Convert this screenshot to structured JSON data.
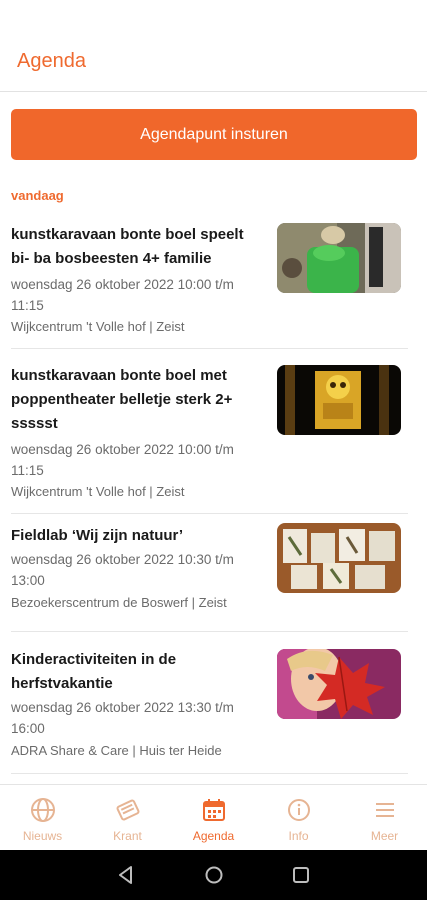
{
  "header": {
    "title": "Agenda"
  },
  "submit_button": {
    "label": "Agendapunt insturen"
  },
  "section": {
    "label": "vandaag"
  },
  "events": [
    {
      "title": "kunstkaravaan bonte boel speelt bi- ba bosbeesten 4+ familie",
      "date_line1": "woensdag 26 oktober 2022 10:00 t/m",
      "date_line2": "11:15",
      "location": "Wijkcentrum 't Volle hof | Zeist",
      "thumbnail_icon": "puppet-photo"
    },
    {
      "title": "kunstkaravaan bonte boel met poppentheater belletje sterk 2+ ssssst",
      "date_line1": "woensdag 26 oktober 2022 10:00 t/m",
      "date_line2": "11:15",
      "location": "Wijkcentrum 't Volle hof | Zeist",
      "thumbnail_icon": "theater-photo"
    },
    {
      "title": "Fieldlab ‘Wij zijn natuur’",
      "date_line1": "woensdag 26 oktober 2022 10:30 t/m",
      "date_line2": "13:00",
      "location": "Bezoekerscentrum de Boswerf | Zeist",
      "thumbnail_icon": "nature-cards-photo"
    },
    {
      "title": "Kinderactiviteiten in de herfstvakantie",
      "date_line1": "woensdag 26 oktober 2022 13:30 t/m",
      "date_line2": "16:00",
      "location": "ADRA Share & Care | Huis ter Heide",
      "thumbnail_icon": "autumn-leaf-photo"
    }
  ],
  "nav": {
    "items": [
      {
        "label": "Nieuws",
        "icon": "globe-icon"
      },
      {
        "label": "Krant",
        "icon": "newspaper-icon"
      },
      {
        "label": "Agenda",
        "icon": "calendar-icon",
        "active": true
      },
      {
        "label": "Info",
        "icon": "info-icon"
      },
      {
        "label": "Meer",
        "icon": "menu-icon"
      }
    ]
  },
  "colors": {
    "accent": "#ef6a2f",
    "nav_inactive": "#e6b493"
  }
}
